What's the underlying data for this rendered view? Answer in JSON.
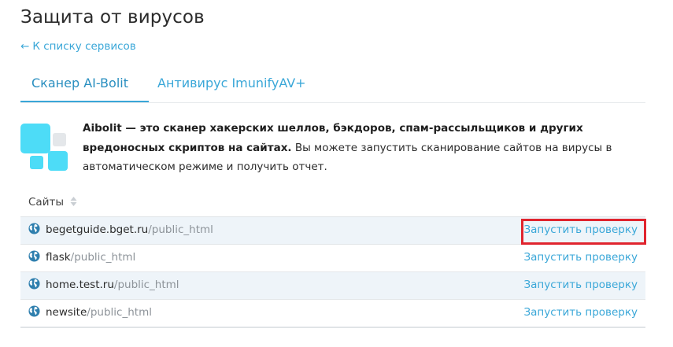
{
  "header": {
    "title": "Защита от вирусов",
    "back_arrow": "←",
    "back_link": "К списку сервисов"
  },
  "tabs": [
    {
      "label": "Сканер AI-Bolit",
      "active": true
    },
    {
      "label": "Антивирус ImunifyAV+",
      "active": false
    }
  ],
  "description": {
    "bold": "Aibolit — это сканер хакерских шеллов, бэкдоров, спам-рассыльщиков и других вредоносных скриптов на сайтах.",
    "text": " Вы можете запустить сканирование сайтов на вирусы в автоматическом режиме и получить отчет."
  },
  "table": {
    "column": "Сайты",
    "sort_icon": "sort-icon",
    "rows": [
      {
        "host": "begetguide.bget.ru",
        "path": "/public_html",
        "action": "Запустить проверку",
        "highlighted": true
      },
      {
        "host": "flask",
        "path": "/public_html",
        "action": "Запустить проверку",
        "highlighted": false
      },
      {
        "host": "home.test.ru",
        "path": "/public_html",
        "action": "Запустить проверку",
        "highlighted": false
      },
      {
        "host": "newsite",
        "path": "/public_html",
        "action": "Запустить проверку",
        "highlighted": false
      }
    ]
  },
  "colors": {
    "accent": "#3aa7d8",
    "row_stripe": "#eef4f9",
    "highlight": "#e0242e",
    "logo_cyan": "#3fd6f5",
    "logo_gray": "#e4e7ea"
  },
  "icons": {
    "site": "globe-icon",
    "logo": "aibolit-logo-icon"
  }
}
